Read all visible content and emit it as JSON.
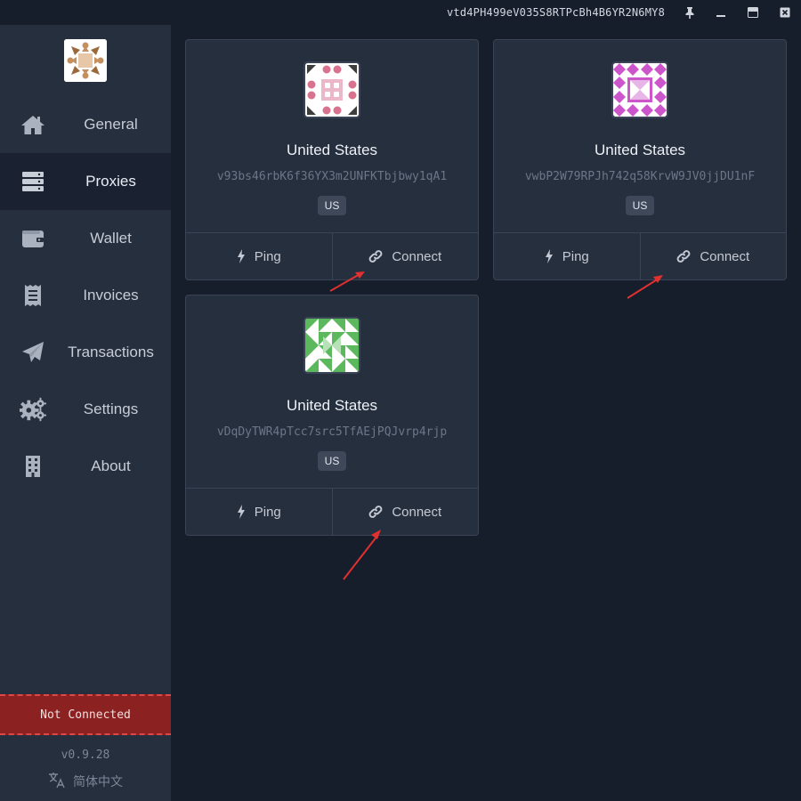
{
  "titlebar": {
    "wallet_id": "vtd4PH499eV035S8RTPcBh4B6YR2N6MY8",
    "icons": [
      "pin-icon",
      "minimize-icon",
      "maximize-icon",
      "close-icon"
    ]
  },
  "sidebar": {
    "items": [
      {
        "label": "General",
        "icon": "home-icon"
      },
      {
        "label": "Proxies",
        "icon": "server-icon",
        "active": true
      },
      {
        "label": "Wallet",
        "icon": "wallet-icon"
      },
      {
        "label": "Invoices",
        "icon": "receipt-icon"
      },
      {
        "label": "Transactions",
        "icon": "paper-plane-icon"
      },
      {
        "label": "Settings",
        "icon": "gears-icon"
      },
      {
        "label": "About",
        "icon": "building-icon"
      }
    ],
    "status": "Not Connected",
    "version": "v0.9.28",
    "language": "简体中文"
  },
  "proxies": [
    {
      "country": "United States",
      "address": "v93bs46rbK6f36YX3m2UNFKTbjbwy1qA1",
      "code": "US",
      "ping_label": "Ping",
      "connect_label": "Connect",
      "identicon_color": "#d9728f"
    },
    {
      "country": "United States",
      "address": "vwbP2W79RPJh742q58KrvW9JV0jjDU1nF",
      "code": "US",
      "ping_label": "Ping",
      "connect_label": "Connect",
      "identicon_color": "#cc55cc"
    },
    {
      "country": "United States",
      "address": "vDqDyTWR4pTcc7src5TfAEjPQJvrp4rjp",
      "code": "US",
      "ping_label": "Ping",
      "connect_label": "Connect",
      "identicon_color": "#5cb85c"
    }
  ],
  "colors": {
    "background": "#161d2b",
    "sidebar": "#252f3e",
    "status_bar": "#8c2121",
    "annotation_arrow": "#e03030"
  }
}
